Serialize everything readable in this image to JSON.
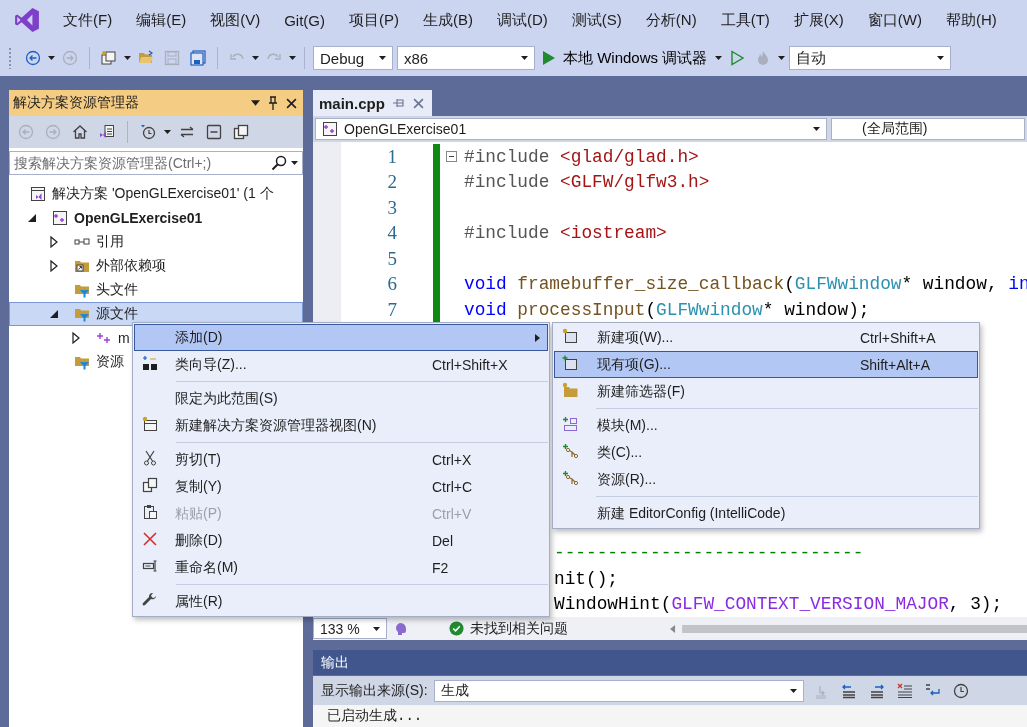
{
  "menu_bar": {
    "items": [
      "文件(F)",
      "编辑(E)",
      "视图(V)",
      "Git(G)",
      "项目(P)",
      "生成(B)",
      "调试(D)",
      "测试(S)",
      "分析(N)",
      "工具(T)",
      "扩展(X)",
      "窗口(W)",
      "帮助(H)"
    ]
  },
  "toolbar": {
    "buttons": [
      {
        "disabled": false
      },
      {
        "disabled": true
      },
      {
        "disabled": false
      },
      {
        "disabled": false
      },
      {
        "disabled": true
      },
      {
        "disabled": false
      },
      {
        "disabled": true
      },
      {
        "disabled": true
      }
    ],
    "configuration": "Debug",
    "platform": "x86",
    "debugger": "本地 Windows 调试器",
    "debug_buttons": [
      {
        "disabled": false
      },
      {
        "disabled": true
      }
    ],
    "mode": "自动"
  },
  "solution_explorer": {
    "title": "解决方案资源管理器",
    "toolbar": [
      {
        "disabled": true
      },
      {
        "disabled": true
      },
      {
        "disabled": false
      },
      {
        "disabled": false
      },
      {
        "disabled": false
      },
      {
        "disabled": false
      },
      {
        "disabled": false
      },
      {
        "disabled": false
      }
    ],
    "search": {
      "placeholder": "搜索解决方案资源管理器(Ctrl+;)"
    },
    "tree": [
      {
        "label": "解决方案 'OpenGLExercise01' (1 个",
        "kind": "solution",
        "bold": false,
        "selected": false,
        "children": [
          {
            "label": "OpenGLExercise01",
            "kind": "project",
            "expanded": true,
            "bold": true,
            "selected": false,
            "children": [
              {
                "label": "引用",
                "kind": "references",
                "expanded": false,
                "bold": false,
                "selected": false
              },
              {
                "label": "外部依赖项",
                "kind": "external",
                "expanded": false,
                "bold": false,
                "selected": false
              },
              {
                "label": "头文件",
                "kind": "filter",
                "bold": false,
                "selected": false
              },
              {
                "label": "源文件",
                "kind": "filter",
                "expanded": true,
                "bold": false,
                "selected": true,
                "children": [
                  {
                    "label": "m",
                    "kind": "file",
                    "expanded": false,
                    "bold": false,
                    "selected": false
                  }
                ]
              },
              {
                "label": "资源",
                "kind": "filter",
                "bold": false,
                "selected": false
              }
            ]
          }
        ]
      }
    ]
  },
  "editor": {
    "tabs": [
      {
        "label": "main.cpp",
        "selected": true
      }
    ],
    "nav": {
      "project": "OpenGLExercise01",
      "scope": "(全局范围)"
    },
    "lines": [
      {
        "number": "1",
        "changed": true,
        "tokens": [
          {
            "kind": "directive",
            "text": "#include "
          },
          {
            "kind": "header",
            "text": "<glad/glad.h>"
          }
        ]
      },
      {
        "number": "2",
        "changed": true,
        "tokens": [
          {
            "kind": "directive",
            "text": "#include "
          },
          {
            "kind": "header",
            "text": "<GLFW/glfw3.h>"
          }
        ]
      },
      {
        "number": "3",
        "changed": true
      },
      {
        "number": "4",
        "changed": true,
        "tokens": [
          {
            "kind": "directive",
            "text": "#include "
          },
          {
            "kind": "header",
            "text": "<iostream>"
          }
        ]
      },
      {
        "number": "5",
        "changed": true
      },
      {
        "number": "6",
        "changed": true,
        "tokens": [
          {
            "kind": "keyword",
            "text": "void"
          },
          {
            "kind": "func",
            "text": " framebuffer_size_callback"
          },
          {
            "kind": "plain",
            "text": "("
          },
          {
            "kind": "type",
            "text": "GLFWwindow"
          },
          {
            "kind": "plain",
            "text": "* window, "
          },
          {
            "kind": "keyword",
            "text": "in"
          }
        ]
      },
      {
        "number": "7",
        "changed": true,
        "tokens": [
          {
            "kind": "keyword",
            "text": "void"
          },
          {
            "kind": "func",
            "text": " processInput"
          },
          {
            "kind": "plain",
            "text": "("
          },
          {
            "kind": "type",
            "text": "GLFWwindow"
          },
          {
            "kind": "plain",
            "text": "* window);"
          }
        ]
      }
    ],
    "visible_fragments": [
      [
        {
          "kind": "comment",
          "text": "-----------------------------"
        }
      ],
      [
        {
          "kind": "plain",
          "text": "nit();"
        }
      ],
      [
        {
          "kind": "plain",
          "text": "WindowHint("
        },
        {
          "kind": "macro",
          "text": "GLFW_CONTEXT_VERSION_MAJOR"
        },
        {
          "kind": "plain",
          "text": ", 3);"
        }
      ]
    ],
    "status": {
      "zoom": "133 %",
      "message": "未找到相关问题"
    }
  },
  "context_menu": [
    {
      "kind": "submenu",
      "label": "添加(D)",
      "selected": true,
      "disabled": false
    },
    {
      "kind": "item",
      "label": "类向导(Z)...",
      "shortcut": "Ctrl+Shift+X",
      "selected": false,
      "disabled": false
    },
    {
      "kind": "separator"
    },
    {
      "kind": "item",
      "label": "限定为此范围(S)",
      "selected": false,
      "disabled": false
    },
    {
      "kind": "item",
      "label": "新建解决方案资源管理器视图(N)",
      "selected": false,
      "disabled": false
    },
    {
      "kind": "separator"
    },
    {
      "kind": "item",
      "label": "剪切(T)",
      "shortcut": "Ctrl+X",
      "selected": false,
      "disabled": false
    },
    {
      "kind": "item",
      "label": "复制(Y)",
      "shortcut": "Ctrl+C",
      "selected": false,
      "disabled": false
    },
    {
      "kind": "item",
      "label": "粘贴(P)",
      "shortcut": "Ctrl+V",
      "selected": false,
      "disabled": true
    },
    {
      "kind": "item",
      "label": "删除(D)",
      "shortcut": "Del",
      "selected": false,
      "disabled": false
    },
    {
      "kind": "item",
      "label": "重命名(M)",
      "shortcut": "F2",
      "selected": false,
      "disabled": false
    },
    {
      "kind": "separator"
    },
    {
      "kind": "item",
      "label": "属性(R)",
      "selected": false,
      "disabled": false
    }
  ],
  "submenu": [
    {
      "kind": "item",
      "label": "新建项(W)...",
      "shortcut": "Ctrl+Shift+A",
      "selected": false,
      "disabled": false
    },
    {
      "kind": "item",
      "label": "现有项(G)...",
      "shortcut": "Shift+Alt+A",
      "selected": true,
      "disabled": false
    },
    {
      "kind": "item",
      "label": "新建筛选器(F)",
      "selected": false,
      "disabled": false
    },
    {
      "kind": "separator"
    },
    {
      "kind": "item",
      "label": "模块(M)...",
      "selected": false,
      "disabled": false
    },
    {
      "kind": "item",
      "label": "类(C)...",
      "selected": false,
      "disabled": false
    },
    {
      "kind": "item",
      "label": "资源(R)...",
      "selected": false,
      "disabled": false
    },
    {
      "kind": "separator"
    },
    {
      "kind": "item",
      "label": "新建 EditorConfig (IntelliCode)",
      "selected": false,
      "disabled": false
    }
  ],
  "output": {
    "title": "输出",
    "source_label": "显示输出来源(S):",
    "source": "生成",
    "toolbar": [
      {
        "disabled": true
      },
      {
        "disabled": false
      },
      {
        "disabled": false
      },
      {
        "disabled": false
      },
      {
        "disabled": false
      },
      {
        "disabled": false
      }
    ],
    "text": "已启动生成..."
  }
}
